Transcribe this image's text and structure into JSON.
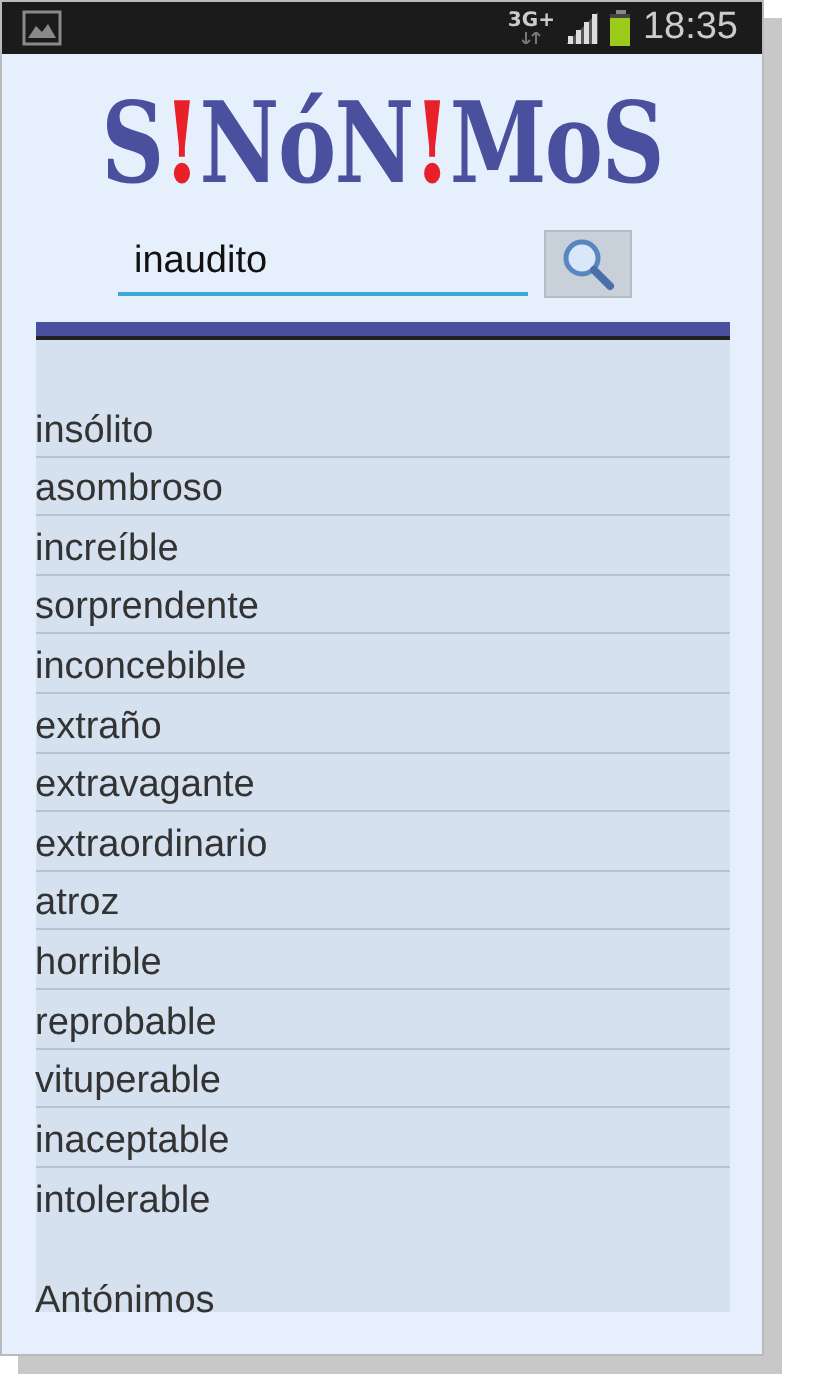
{
  "status_bar": {
    "network": "3G+",
    "time": "18:35"
  },
  "logo": {
    "letters": [
      {
        "text": "S",
        "color": "#4a4f9e"
      },
      {
        "text": "!",
        "color": "#e8202a"
      },
      {
        "text": "N",
        "color": "#4a4f9e"
      },
      {
        "text": "ó",
        "color": "#4a4f9e"
      },
      {
        "text": "N",
        "color": "#4a4f9e"
      },
      {
        "text": "!",
        "color": "#e8202a"
      },
      {
        "text": "M",
        "color": "#4a4f9e"
      },
      {
        "text": "o",
        "color": "#4a4f9e"
      },
      {
        "text": "S",
        "color": "#4a4f9e"
      }
    ]
  },
  "search": {
    "value": "inaudito"
  },
  "synonyms": [
    "insólito",
    "asombroso",
    "increíble",
    "sorprendente",
    "inconcebible",
    "extraño",
    "extravagante",
    "extraordinario",
    "atroz",
    "horrible",
    "reprobable",
    "vituperable",
    "inaceptable",
    "intolerable"
  ],
  "antonyms_heading": "Antónimos"
}
